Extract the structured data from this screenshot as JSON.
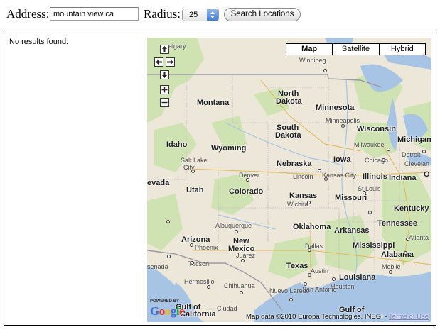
{
  "form": {
    "address_label": "Address:",
    "address_value": "mountain view ca",
    "radius_label": "Radius:",
    "radius_value": "25",
    "search_button": "Search Locations"
  },
  "results": {
    "message": "No results found."
  },
  "map": {
    "types": [
      "Map",
      "Satellite",
      "Hybrid"
    ],
    "selected_type": "Map",
    "attribution": "Map data ©2010 Europa Technologies, INEGI -",
    "terms_link": "Terms of Use",
    "logo_powered": "POWERED BY",
    "logo_text": "Google",
    "state_labels": {
      "montana": "Montana",
      "north_dakota": "North Dakota",
      "north_dakota_1": "North",
      "north_dakota_2": "Dakota",
      "minnesota": "Minnesota",
      "south_dakota_1": "South",
      "south_dakota_2": "Dakota",
      "wisconsin": "Wisconsin",
      "michigan": "Michigan",
      "idaho": "Idaho",
      "wyoming": "Wyoming",
      "iowa": "Iowa",
      "nebraska": "Nebraska",
      "illinois": "Illinois",
      "indiana": "Indiana",
      "oh": "O",
      "nevada": "evada",
      "utah": "Utah",
      "colorado": "Colorado",
      "kansas": "Kansas",
      "missouri": "Missouri",
      "kentucky": "Kentucky",
      "tennessee": "Tennessee",
      "oklahoma": "Oklahoma",
      "arkansas": "Arkansas",
      "arizona": "Arizona",
      "new_mexico_1": "New",
      "new_mexico_2": "Mexico",
      "mississippi": "Mississippi",
      "alabama": "Alabama",
      "texas": "Texas",
      "louisiana": "Louisiana",
      "gulf1": "Gulf of",
      "gulf1b": "California",
      "gulf2": "Gulf of"
    },
    "city_labels": {
      "calgary": "algary",
      "winnipeg": "Winnipeg",
      "minneapolis": "Minneapolis",
      "milwaukee": "Milwaukee",
      "detroit": "Detroit",
      "chicago": "Chicago",
      "cleveland": "Clevelan",
      "salt_lake": "Salt Lake",
      "city": "City",
      "denver": "Denver",
      "lincoln": "Lincoln",
      "kansas_city": "Kansas City",
      "st_louis": "St Louis",
      "wichita": "Wichita",
      "albuquerque": "Albuquerque",
      "phoenix": "Phoenix",
      "tucson": "Tucson",
      "juarez": "Juarez",
      "dallas": "Dallas",
      "atlanta": "Atlanta",
      "austin": "Austin",
      "houston": "Houston",
      "san_antonio": "San Antonio",
      "mobile": "Mobile",
      "hermosillo": "Hermosillo",
      "chihuahua": "Chihuahua",
      "nuevo_laredo": "Nuevo Laredo",
      "ciudad": "Ciudad",
      "ensenada": "senada"
    }
  }
}
